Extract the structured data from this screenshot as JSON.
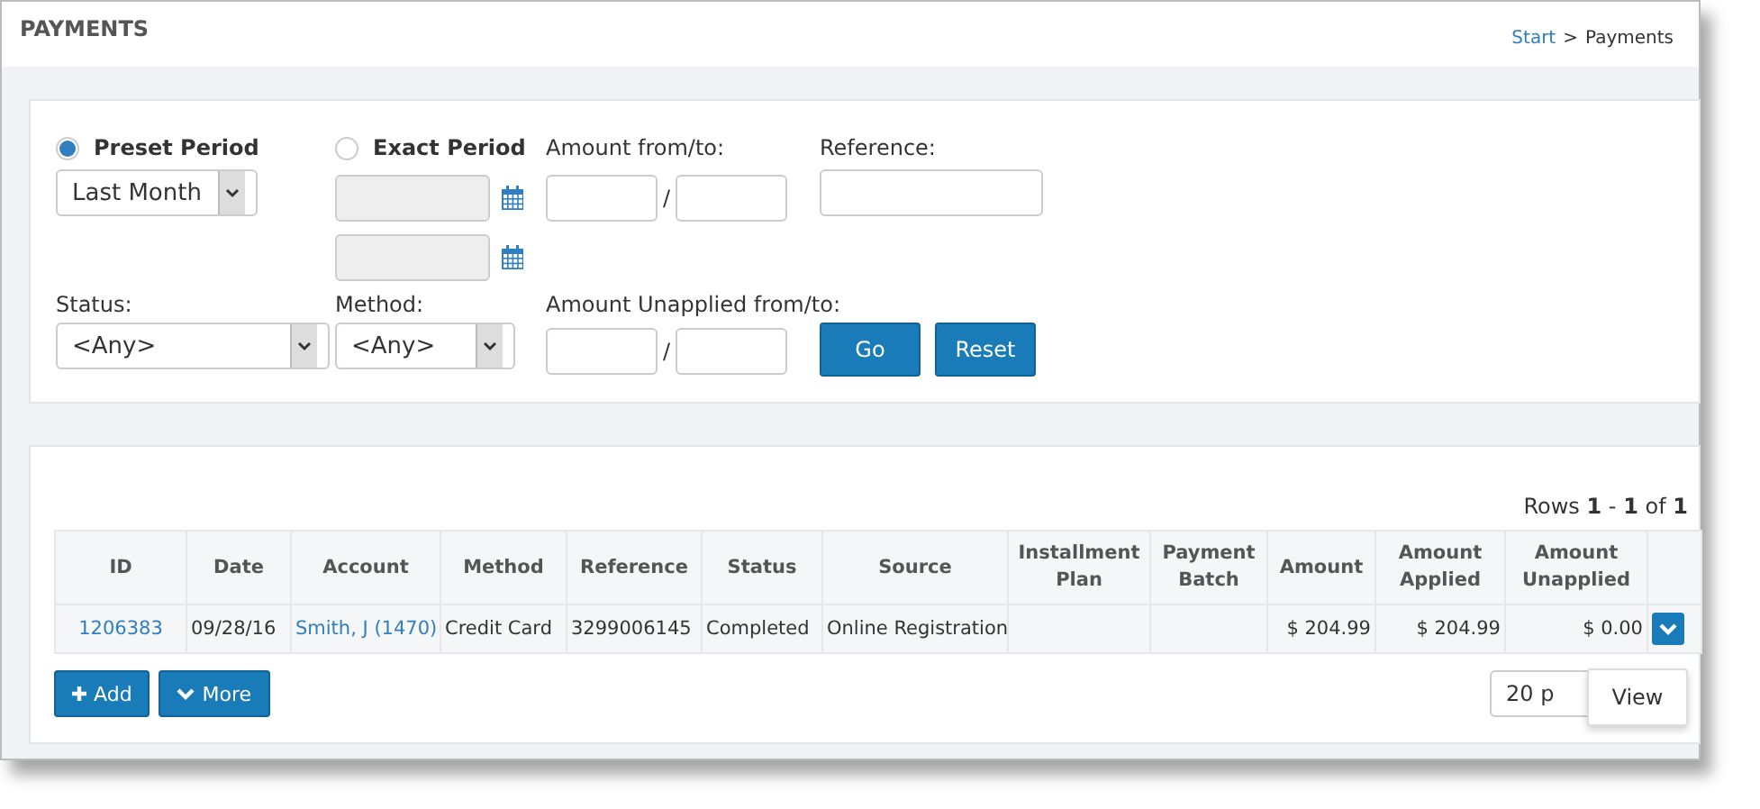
{
  "page": {
    "title": "PAYMENTS",
    "breadcrumb": {
      "link": "Start",
      "separator": ">",
      "current": "Payments"
    }
  },
  "filters": {
    "period_options": [
      {
        "label": "Preset Period",
        "selected": true
      },
      {
        "label": "Exact Period",
        "selected": false
      }
    ],
    "preset_value": "Last Month",
    "amount_label": "Amount from/to:",
    "separator": "/",
    "reference_label": "Reference:",
    "status_label": "Status:",
    "status_value": "<Any>",
    "method_label": "Method:",
    "method_value": "<Any>",
    "unapplied_label": "Amount Unapplied from/to:",
    "unapplied_separator": "/",
    "buttons": [
      "Go",
      "Reset"
    ]
  },
  "table": {
    "rows_info": "Rows **1** - **1** of **1**",
    "columns": [
      "ID",
      "Date",
      "Account",
      "Method",
      "Reference",
      "Status",
      "Source",
      "Installment Plan",
      "Payment Batch",
      "Amount",
      "Amount Applied",
      "Amount Unapplied"
    ],
    "rows": [
      {
        "cells": [
          {
            "text": "1206383",
            "kind": "link"
          },
          {
            "text": "09/28/16",
            "kind": "text"
          },
          {
            "text": "Smith, J (1470)",
            "kind": "link"
          },
          {
            "text": "Credit Card",
            "kind": "text"
          },
          {
            "text": "3299006145",
            "kind": "text"
          },
          {
            "text": "Completed",
            "kind": "text"
          },
          {
            "text": "Online Registration",
            "kind": "text"
          },
          {
            "text": "",
            "kind": "text"
          },
          {
            "text": "",
            "kind": "text"
          },
          {
            "text": "$ 204.99",
            "kind": "money"
          },
          {
            "text": "$ 204.99",
            "kind": "money"
          },
          {
            "text": "$ 0.00",
            "kind": "money"
          }
        ]
      }
    ],
    "buttons": [
      {
        "label": "Add",
        "kind": "add"
      },
      {
        "label": "More",
        "kind": "more"
      }
    ],
    "page_size": "20 p",
    "row_menu": [
      "View"
    ]
  }
}
